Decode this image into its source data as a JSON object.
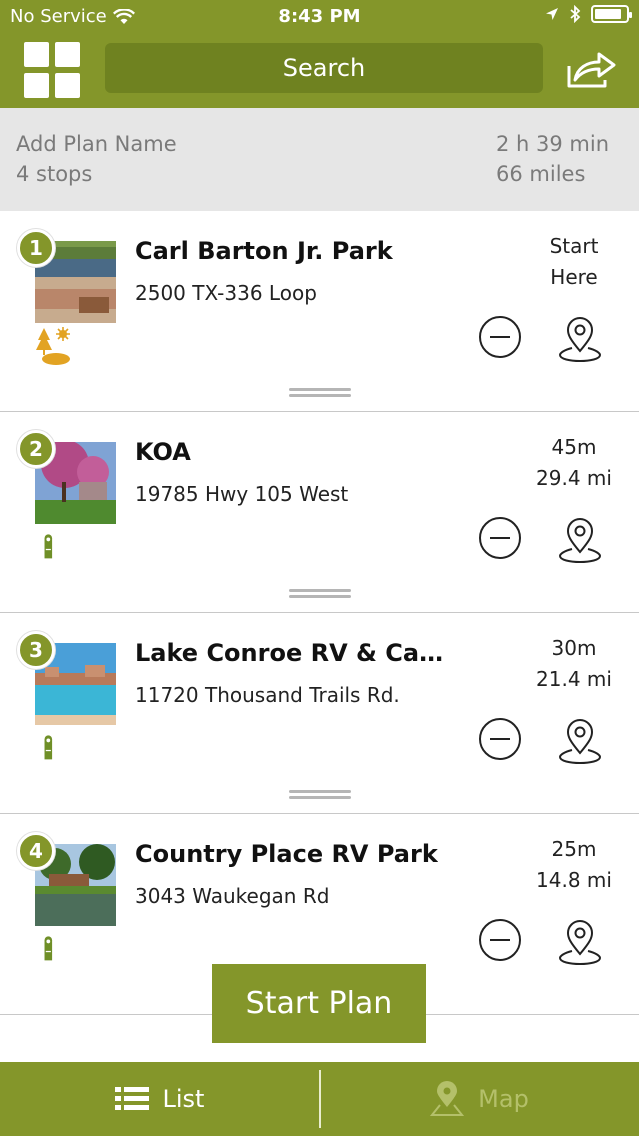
{
  "status_bar": {
    "carrier": "No Service",
    "time": "8:43 PM",
    "battery_level": 0.85
  },
  "header": {
    "search_label": "Search",
    "menu_icon": "grid-icon",
    "share_icon": "share-icon"
  },
  "plan": {
    "name_placeholder": "Add Plan Name",
    "stops_count": "4 stops",
    "duration": "2 h 39 min",
    "distance": "66 miles"
  },
  "stops": [
    {
      "number": "1",
      "name": "Carl Barton Jr. Park",
      "address": "2500 TX-336 Loop",
      "eta_line1": "Start",
      "eta_line2": "Here",
      "amenity_icon": "park-icon"
    },
    {
      "number": "2",
      "name": "KOA",
      "address": "19785 Hwy 105 West",
      "eta_line1": "45m",
      "eta_line2": "29.4 mi",
      "amenity_icon": "door-hanger-icon"
    },
    {
      "number": "3",
      "name": "Lake Conroe RV & Campi...",
      "address": "11720 Thousand Trails Rd.",
      "eta_line1": "30m",
      "eta_line2": "21.4 mi",
      "amenity_icon": "door-hanger-icon"
    },
    {
      "number": "4",
      "name": "Country Place RV Park",
      "address": "3043 Waukegan Rd",
      "eta_line1": "25m",
      "eta_line2": "14.8 mi",
      "amenity_icon": "door-hanger-icon"
    }
  ],
  "start_button": "Start Plan",
  "tabs": {
    "list": "List",
    "map": "Map"
  },
  "colors": {
    "brand_green": "#84962a",
    "search_green": "#6f8220",
    "summary_bg": "#e6e6e6"
  }
}
